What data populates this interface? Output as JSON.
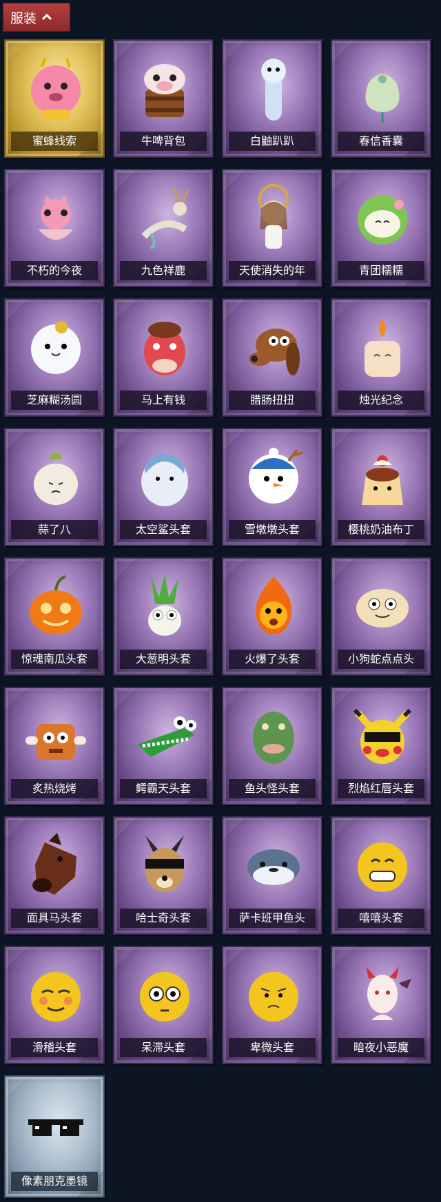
{
  "header": {
    "label": "服装",
    "icon": "chevron-up-icon"
  },
  "items": [
    {
      "name": "蜜蜂线索",
      "rarity": "gold",
      "icon": "bee-costume-plush-icon"
    },
    {
      "name": "牛啤背包",
      "rarity": "purple",
      "icon": "cow-beer-barrel-icon"
    },
    {
      "name": "白鼬趴趴",
      "rarity": "purple",
      "icon": "white-weasel-plush-icon"
    },
    {
      "name": "春信香囊",
      "rarity": "purple",
      "icon": "sachet-pouch-icon"
    },
    {
      "name": "不朽的今夜",
      "rarity": "purple",
      "icon": "pink-fox-bowl-icon"
    },
    {
      "name": "九色祥鹿",
      "rarity": "purple",
      "icon": "deer-charm-icon"
    },
    {
      "name": "天使消失的年",
      "rarity": "purple",
      "icon": "angel-doll-icon"
    },
    {
      "name": "青团糯糯",
      "rarity": "purple",
      "icon": "green-rice-ball-icon"
    },
    {
      "name": "芝麻糊汤圆",
      "rarity": "purple",
      "icon": "rice-dumpling-icon"
    },
    {
      "name": "马上有钱",
      "rarity": "purple",
      "icon": "red-horse-head-icon"
    },
    {
      "name": "腊肠扭扭",
      "rarity": "purple",
      "icon": "dachshund-head-icon"
    },
    {
      "name": "烛光纪念",
      "rarity": "purple",
      "icon": "candle-head-icon"
    },
    {
      "name": "蒜了八",
      "rarity": "purple",
      "icon": "garlic-head-icon"
    },
    {
      "name": "太空鲨头套",
      "rarity": "purple",
      "icon": "space-shark-head-icon"
    },
    {
      "name": "雪墩墩头套",
      "rarity": "purple",
      "icon": "snowman-head-icon"
    },
    {
      "name": "樱桃奶油布丁",
      "rarity": "purple",
      "icon": "pudding-head-icon"
    },
    {
      "name": "惊魂南瓜头套",
      "rarity": "purple",
      "icon": "pumpkin-head-icon"
    },
    {
      "name": "大葱明头套",
      "rarity": "purple",
      "icon": "scallion-head-icon"
    },
    {
      "name": "火爆了头套",
      "rarity": "purple",
      "icon": "fire-head-icon"
    },
    {
      "name": "小狗蛇点点头",
      "rarity": "purple",
      "icon": "dog-snake-head-icon"
    },
    {
      "name": "炙热烧烤",
      "rarity": "purple",
      "icon": "grilled-meat-head-icon"
    },
    {
      "name": "鳄霸天头套",
      "rarity": "purple",
      "icon": "crocodile-head-icon"
    },
    {
      "name": "鱼头怪头套",
      "rarity": "purple",
      "icon": "fish-head-icon"
    },
    {
      "name": "烈焰红唇头套",
      "rarity": "purple",
      "icon": "yellow-mouse-sunglasses-head-icon"
    },
    {
      "name": "面具马头套",
      "rarity": "purple",
      "icon": "horse-mask-icon"
    },
    {
      "name": "哈士奇头套",
      "rarity": "purple",
      "icon": "husky-sunglasses-head-icon"
    },
    {
      "name": "萨卡班甲鱼头",
      "rarity": "purple",
      "icon": "sacabambaspis-head-icon"
    },
    {
      "name": "嘻嘻头套",
      "rarity": "purple",
      "icon": "grinning-emoji-head-icon"
    },
    {
      "name": "滑稽头套",
      "rarity": "purple",
      "icon": "funny-emoji-head-icon"
    },
    {
      "name": "呆滞头套",
      "rarity": "purple",
      "icon": "dazed-emoji-head-icon"
    },
    {
      "name": "卑微头套",
      "rarity": "purple",
      "icon": "humble-emoji-head-icon"
    },
    {
      "name": "暗夜小恶魔",
      "rarity": "purple",
      "icon": "little-devil-head-icon"
    },
    {
      "name": "像素朋克墨镜",
      "rarity": "blue",
      "icon": "pixel-sunglasses-icon"
    }
  ],
  "colors": {
    "background": "#0d1525",
    "header_button": "#a23739",
    "purple_card": "#9b7ab8",
    "gold_card": "#e2c25c",
    "blue_card": "#aebfce"
  }
}
